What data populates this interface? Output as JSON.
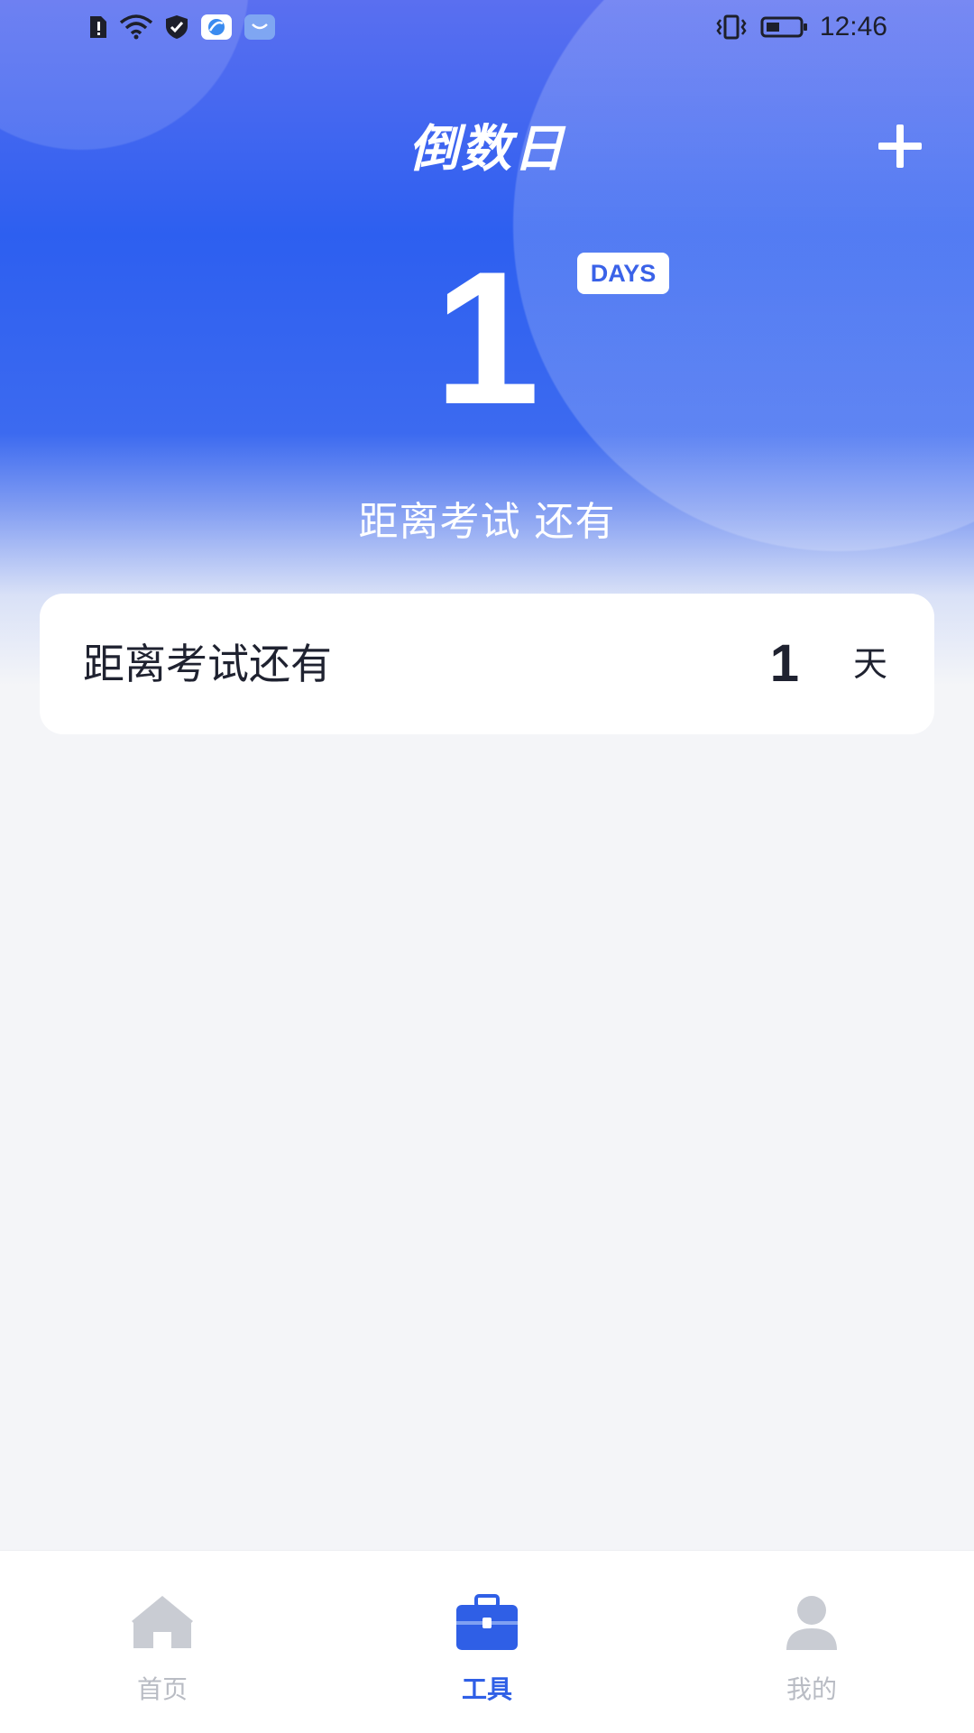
{
  "status_bar": {
    "time": "12:46",
    "icons": [
      "sim-alert-icon",
      "wifi-icon",
      "shield-icon",
      "app-browser-icon",
      "app-notification-icon",
      "vibrate-icon",
      "battery-icon"
    ]
  },
  "header": {
    "title": "倒数日",
    "add_icon": "plus-icon"
  },
  "hero": {
    "days_count": "1",
    "days_badge": "DAYS",
    "subtitle": "距离考试 还有"
  },
  "countdown_list": [
    {
      "label": "距离考试还有",
      "count": "1",
      "unit": "天"
    }
  ],
  "tabbar": {
    "active_tab": "工具",
    "tabs": [
      {
        "label": "首页",
        "icon": "home-icon"
      },
      {
        "label": "工具",
        "icon": "toolbox-icon"
      },
      {
        "label": "我的",
        "icon": "user-icon"
      }
    ]
  },
  "colors": {
    "accent": "#2f5fe6",
    "hero_top": "#5a6ff0",
    "hero_mid": "#2d5ff0",
    "background": "#f4f5f8",
    "tab_inactive": "#b9bcc4",
    "text_dark": "#1f2230"
  }
}
